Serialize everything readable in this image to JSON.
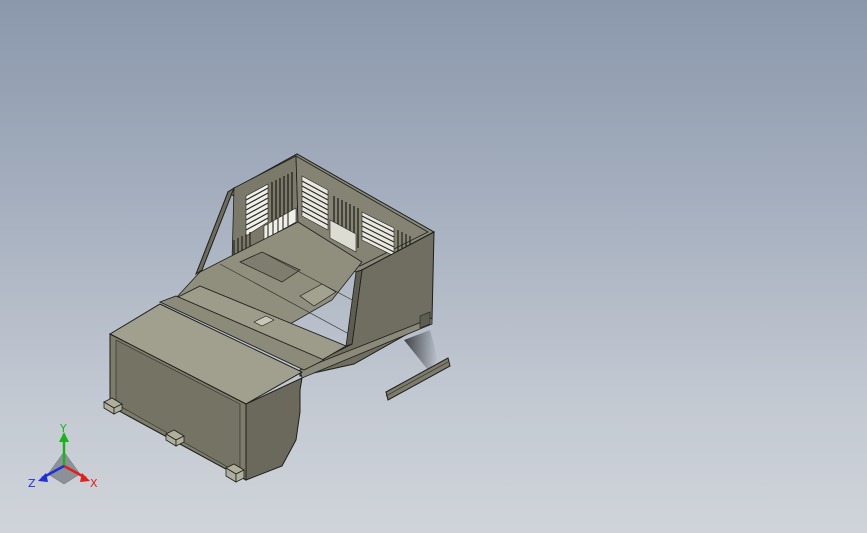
{
  "viewport": {
    "background_top": "#8b98ac",
    "background_bottom": "#d0d4da"
  },
  "model": {
    "body_color": "#7c7b6c",
    "light_color": "#9a9988",
    "dark_color": "#55544a",
    "edge_color": "#1e1e1a"
  },
  "triad": {
    "x_label": "X",
    "y_label": "Y",
    "z_label": "Z",
    "x_color": "#e0201a",
    "y_color": "#18b418",
    "z_color": "#2030d8"
  }
}
